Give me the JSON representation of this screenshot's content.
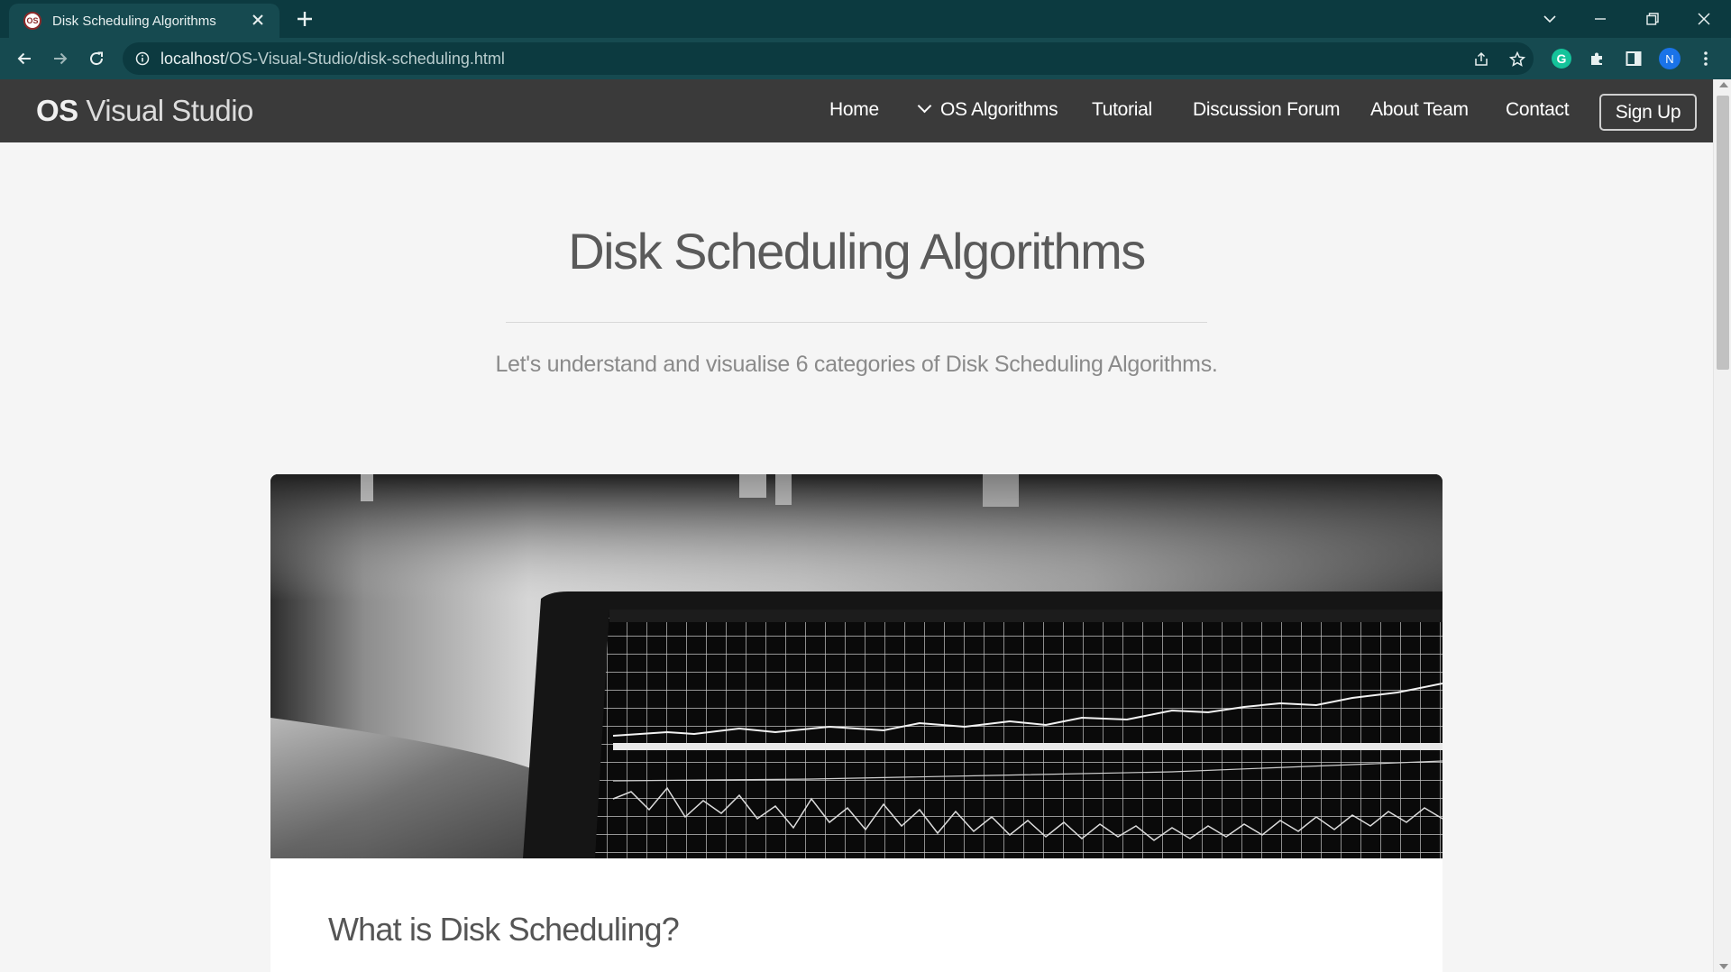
{
  "browser": {
    "tab": {
      "favicon_text": "OS",
      "title": "Disk Scheduling Algorithms",
      "close_icon": "close-icon"
    },
    "new_tab_icon": "plus-icon",
    "window_controls": [
      "chevron-down-icon",
      "minimize-icon",
      "restore-icon",
      "close-icon"
    ],
    "toolbar": {
      "back_icon": "arrow-left-icon",
      "forward_icon": "arrow-right-icon",
      "reload_icon": "reload-icon"
    },
    "omnibox": {
      "host": "localhost",
      "path": "/OS-Visual-Studio/disk-scheduling.html",
      "actions": [
        "share-icon",
        "star-icon"
      ]
    },
    "extensions": {
      "grammarly_label": "G",
      "profile_initial": "N"
    },
    "colors": {
      "chrome_dark": "#0c3a40",
      "chrome_mid": "#164a50",
      "grammarly": "#15c39a",
      "profile": "#1a73e8"
    }
  },
  "site": {
    "brand_bold": "OS",
    "brand_rest": " Visual Studio",
    "nav": {
      "home": "Home",
      "os_algorithms": "OS Algorithms",
      "tutorial": "Tutorial",
      "discussion_forum": "Discussion Forum",
      "about_team": "About Team",
      "contact": "Contact",
      "signup": "Sign Up"
    },
    "colors": {
      "navbar": "#3a3a3a",
      "page_bg": "#f5f5f5"
    }
  },
  "hero": {
    "title": "Disk Scheduling Algorithms",
    "subtitle": "Let's understand and visualise 6 categories of Disk Scheduling Algorithms."
  },
  "content": {
    "image": "laptop-stock-chart-photo",
    "section_heading": "What is Disk Scheduling?"
  }
}
